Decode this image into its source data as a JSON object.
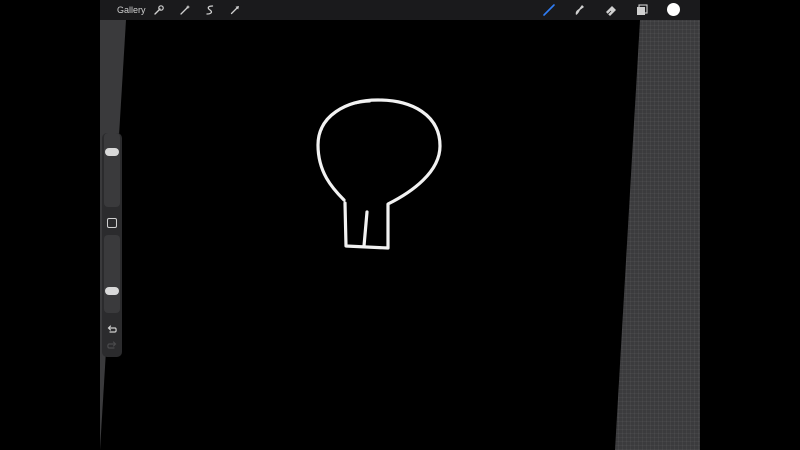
{
  "toolbar": {
    "gallery_label": "Gallery",
    "left_tools": [
      {
        "icon": "wrench-icon",
        "name": "actions"
      },
      {
        "icon": "magic-wand-icon",
        "name": "adjustments"
      },
      {
        "icon": "selection-icon",
        "name": "selection"
      },
      {
        "icon": "arrow-cursor-icon",
        "name": "transform"
      }
    ],
    "right_tools": [
      {
        "icon": "brush-icon",
        "name": "paint",
        "active": true
      },
      {
        "icon": "smudge-icon",
        "name": "smudge"
      },
      {
        "icon": "eraser-icon",
        "name": "eraser"
      },
      {
        "icon": "layers-icon",
        "name": "layers"
      }
    ],
    "active_color": "#ffffff",
    "active_tool_color": "#2f7df6"
  },
  "sidebar": {
    "brush_size_level": 0.78,
    "opacity_level": 0.26
  },
  "colors": {
    "canvas": "#000000",
    "toolbar": "#1a1a1c",
    "panel": "#3a3a3c",
    "stroke": "#f2f2f2"
  }
}
